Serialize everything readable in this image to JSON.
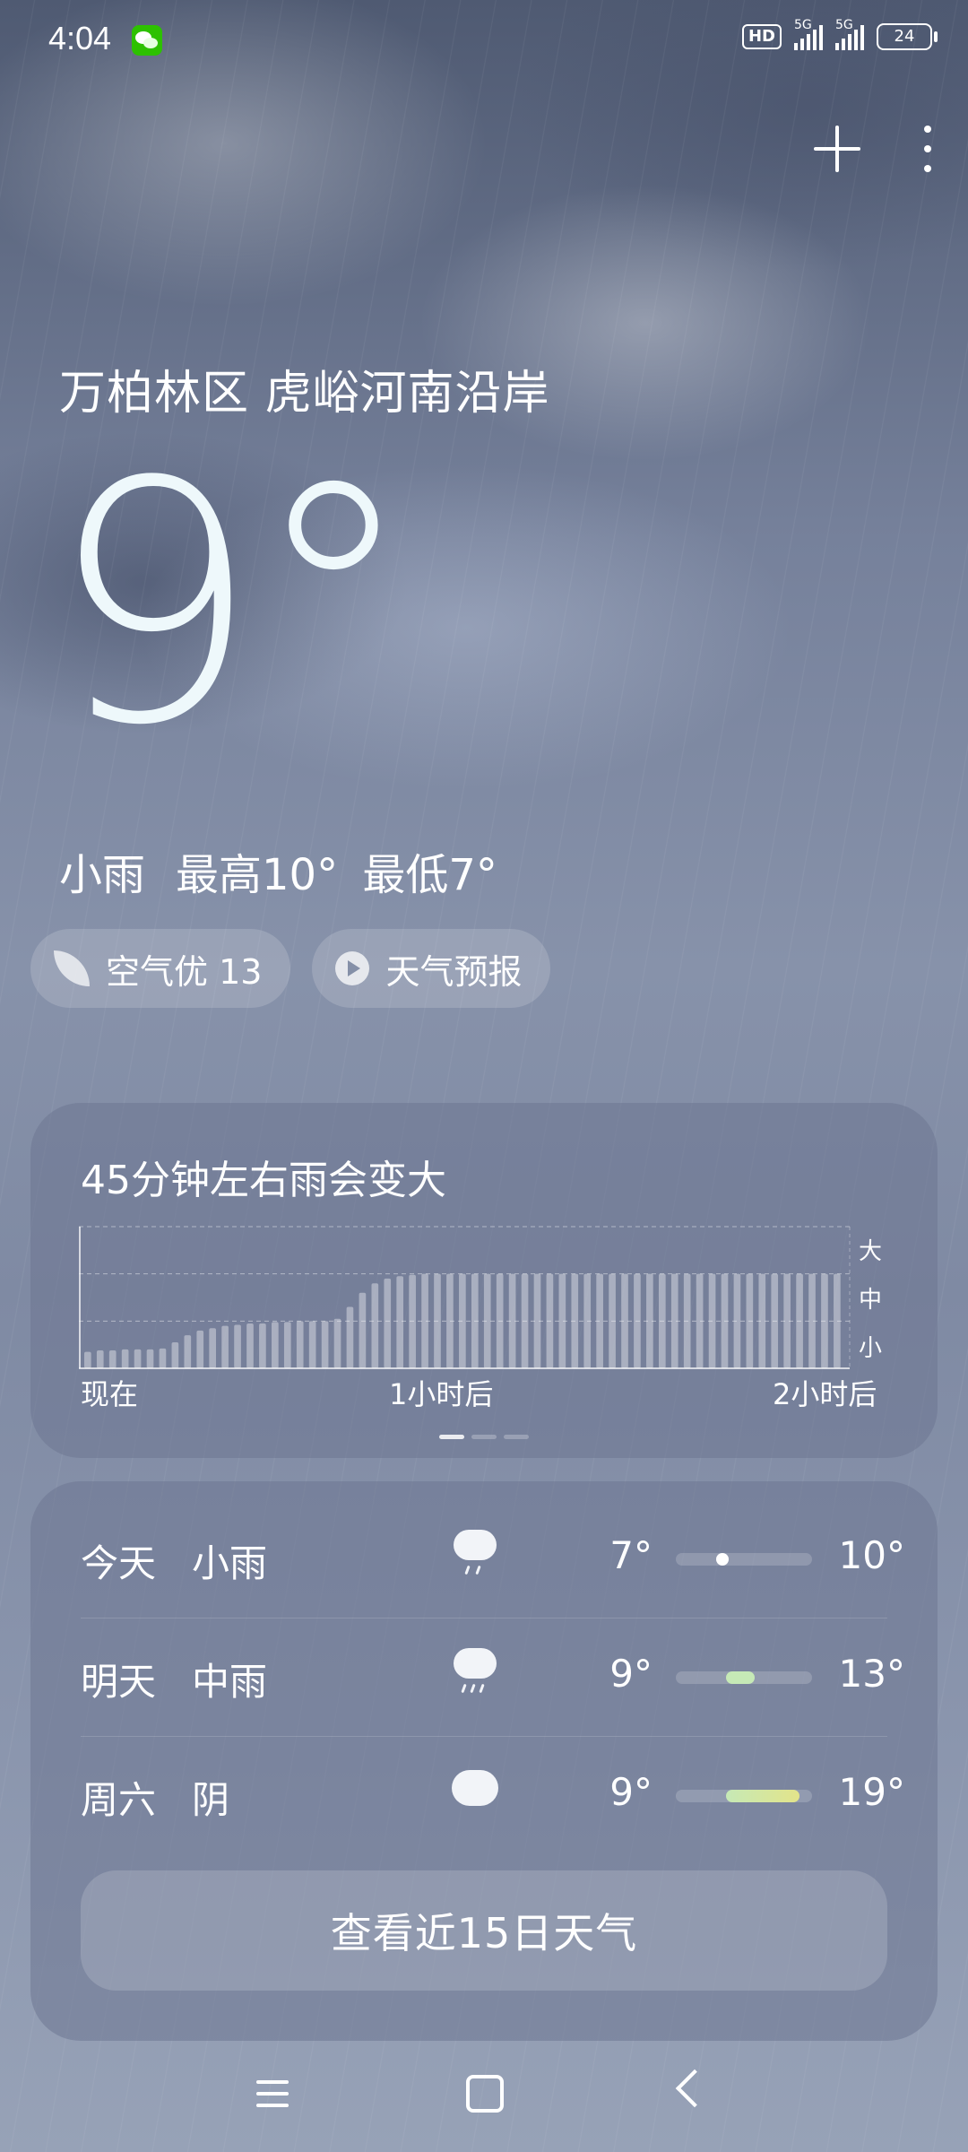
{
  "status_bar": {
    "time": "4:04",
    "hd_label": "HD",
    "net1": "5G",
    "net2": "5G",
    "battery": "24"
  },
  "header": {
    "location": "万柏林区 虎峪河南沿岸"
  },
  "current": {
    "temperature": "9°",
    "condition": "小雨",
    "high": "最高10°",
    "low": "最低7°"
  },
  "chips": {
    "air": "空气优 13",
    "forecast_video": "天气预报"
  },
  "precip_card": {
    "title": "45分钟左右雨会变大",
    "levels": [
      "大",
      "中",
      "小"
    ],
    "x_labels": [
      "现在",
      "1小时后",
      "2小时后"
    ]
  },
  "chart_data": {
    "type": "bar",
    "title": "45分钟左右雨会变大",
    "xlabel": "",
    "ylabel": "",
    "x_tick_labels": [
      "现在",
      "1小时后",
      "2小时后"
    ],
    "y_tick_labels": [
      "小",
      "中",
      "大"
    ],
    "ylim": [
      0,
      3
    ],
    "grid": true,
    "values": [
      0.35,
      0.38,
      0.38,
      0.4,
      0.4,
      0.4,
      0.42,
      0.55,
      0.7,
      0.8,
      0.85,
      0.9,
      0.92,
      0.95,
      0.95,
      0.98,
      0.98,
      1.0,
      1.0,
      1.0,
      1.05,
      1.3,
      1.6,
      1.8,
      1.9,
      1.95,
      1.98,
      2.0,
      2.0,
      2.0,
      2.0,
      2.0,
      2.0,
      2.0,
      2.0,
      2.0,
      2.0,
      2.0,
      2.0,
      2.0,
      2.0,
      2.0,
      2.0,
      2.0,
      2.0,
      2.0,
      2.0,
      2.0,
      2.0,
      2.0,
      2.0,
      2.0,
      2.0,
      2.0,
      2.0,
      2.0,
      2.0,
      2.0,
      2.0,
      2.0,
      2.0
    ]
  },
  "forecast": {
    "rows": [
      {
        "day": "今天",
        "cond": "小雨",
        "icon": "light-rain-icon",
        "low": "7°",
        "high": "10°",
        "low_val": 7,
        "high_val": 10,
        "color": "#ffffff"
      },
      {
        "day": "明天",
        "cond": "中雨",
        "icon": "moderate-rain-icon",
        "low": "9°",
        "high": "13°",
        "low_val": 9,
        "high_val": 13,
        "color": "#c6e9b6"
      },
      {
        "day": "周六",
        "cond": "阴",
        "icon": "overcast-icon",
        "low": "9°",
        "high": "19°",
        "low_val": 9,
        "high_val": 19,
        "color": "#e3e48a"
      }
    ],
    "range_min": 7,
    "range_max": 19,
    "view_more": "查看近15日天气"
  },
  "colors": {
    "accent_green": "#c6e9b6",
    "accent_yellow": "#e3e48a"
  }
}
